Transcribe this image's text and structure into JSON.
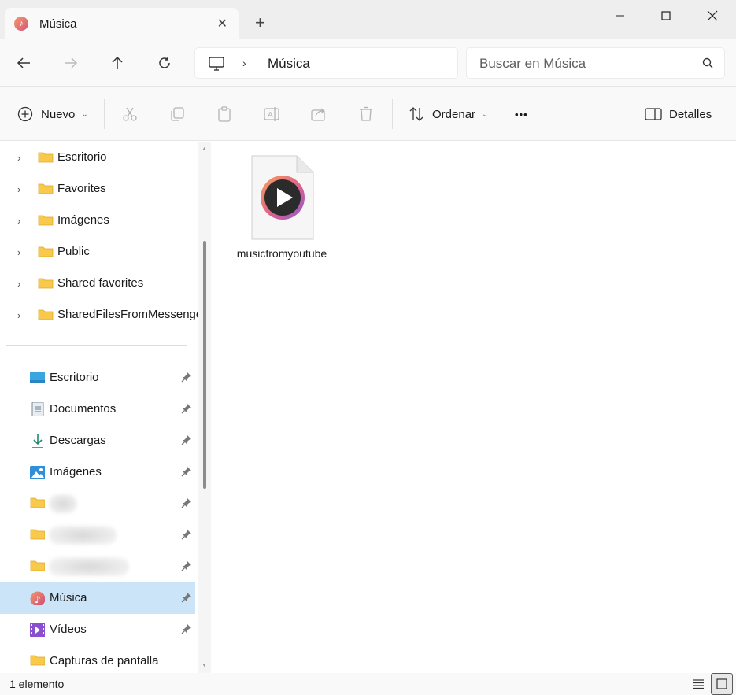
{
  "window": {
    "tab_title": "Música",
    "tab_icon": "music-note-icon",
    "new_tab_symbol": "+"
  },
  "navigation": {
    "breadcrumb_separator": "›",
    "breadcrumb": "Música",
    "search_placeholder": "Buscar en Música"
  },
  "toolbar": {
    "new_label": "Nuevo",
    "sort_label": "Ordenar",
    "more_label": "•••",
    "details_label": "Detalles",
    "icons": [
      "cut-icon",
      "copy-icon",
      "paste-icon",
      "rename-icon",
      "share-icon",
      "delete-icon"
    ]
  },
  "sidebar": {
    "tree_items": [
      {
        "label": "Escritorio"
      },
      {
        "label": "Favorites"
      },
      {
        "label": "Imágenes"
      },
      {
        "label": "Public"
      },
      {
        "label": "Shared favorites"
      },
      {
        "label": "SharedFilesFromMessenge"
      }
    ],
    "quick_access": [
      {
        "label": "Escritorio",
        "icon": "desktop-icon",
        "pinned": true
      },
      {
        "label": "Documentos",
        "icon": "documents-icon",
        "pinned": true
      },
      {
        "label": "Descargas",
        "icon": "download-icon",
        "pinned": true
      },
      {
        "label": "Imágenes",
        "icon": "pictures-icon",
        "pinned": true
      },
      {
        "label": "",
        "icon": "folder-icon",
        "pinned": true,
        "blurred": true
      },
      {
        "label": "",
        "icon": "folder-icon",
        "pinned": true,
        "blurred": true
      },
      {
        "label": "",
        "icon": "folder-icon",
        "pinned": true,
        "blurred": true
      },
      {
        "label": "Música",
        "icon": "music-icon",
        "pinned": true,
        "selected": true
      },
      {
        "label": "Vídeos",
        "icon": "videos-icon",
        "pinned": true
      },
      {
        "label": "Capturas de pantalla",
        "icon": "folder-icon",
        "pinned": false
      }
    ]
  },
  "content": {
    "files": [
      {
        "name": "musicfromyoutube",
        "icon": "media-file-icon"
      }
    ]
  },
  "statusbar": {
    "item_count": "1 elemento"
  },
  "colors": {
    "selection": "#cce4f7",
    "folder": "#f8c94a",
    "accent": "#0067c0"
  }
}
